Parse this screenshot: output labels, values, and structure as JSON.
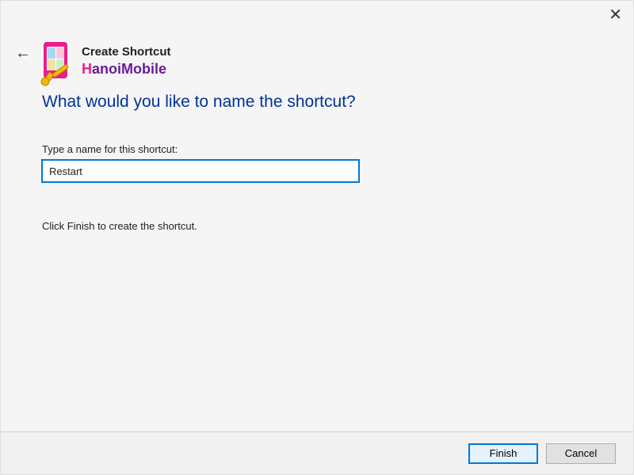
{
  "window": {
    "close_glyph": "✕"
  },
  "header": {
    "back_glyph": "←",
    "wizard_title": "Create Shortcut",
    "brand_h": "H",
    "brand_rest": "anoiMobile"
  },
  "main": {
    "heading": "What would you like to name the shortcut?",
    "input_label": "Type a name for this shortcut:",
    "input_value": "Restart",
    "instruction": "Click Finish to create the shortcut."
  },
  "buttons": {
    "finish": "Finish",
    "cancel": "Cancel"
  },
  "colors": {
    "heading_blue": "#003399",
    "focus_border": "#0078d7",
    "brand_pink": "#e91e8c",
    "brand_purple": "#6a1b9a"
  },
  "icons": {
    "logo": "hanoimobile-logo-icon",
    "close": "close-icon",
    "back": "back-arrow-icon"
  }
}
